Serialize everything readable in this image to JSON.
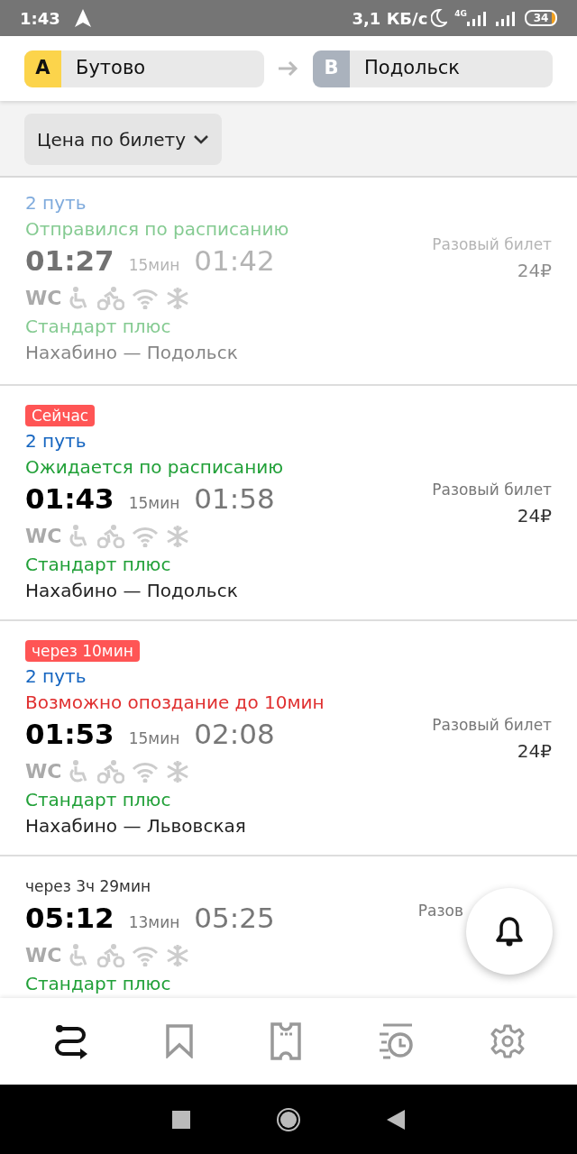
{
  "status_bar": {
    "time": "1:43",
    "speed": "3,1 КБ/с",
    "network": "4G",
    "battery": "34"
  },
  "route": {
    "from": {
      "letter": "A",
      "name": "Бутово"
    },
    "to": {
      "letter": "B",
      "name": "Подольск"
    }
  },
  "filter": {
    "label": "Цена по билету"
  },
  "trains": [
    {
      "departed": true,
      "platform": "2 путь",
      "status": {
        "kind": "departed",
        "text": "Отправился по расписанию"
      },
      "depart": "01:27",
      "duration": "15мин",
      "arrive": "01:42",
      "toilet": "WC",
      "train_class": "Стандарт плюс",
      "route": "Нахабино — Подольск",
      "ticket": "Разовый билет",
      "price": "24₽"
    },
    {
      "departed": false,
      "badge": {
        "kind": "label",
        "text": "Сейчас"
      },
      "platform": "2 путь",
      "status": {
        "kind": "ontime",
        "text": "Ожидается по расписанию"
      },
      "depart": "01:43",
      "duration": "15мин",
      "arrive": "01:58",
      "toilet": "WC",
      "train_class": "Стандарт плюс",
      "route": "Нахабино — Подольск",
      "ticket": "Разовый билет",
      "price": "24₽"
    },
    {
      "departed": false,
      "badge": {
        "kind": "label",
        "text": "через 10мин"
      },
      "platform": "2 путь",
      "status": {
        "kind": "delay",
        "text": "Возможно опоздание до 10мин"
      },
      "depart": "01:53",
      "duration": "15мин",
      "arrive": "02:08",
      "toilet": "WC",
      "train_class": "Стандарт плюс",
      "route": "Нахабино — Львовская",
      "ticket": "Разовый билет",
      "price": "24₽"
    },
    {
      "departed": false,
      "badge": {
        "kind": "plain",
        "text": "через 3ч 29мин"
      },
      "depart": "05:12",
      "duration": "13мин",
      "arrive": "05:25",
      "toilet": "WC",
      "train_class": "Стандарт плюс",
      "ticket": "Разов"
    }
  ],
  "tabs": [
    {
      "selected": true
    },
    {
      "selected": false
    },
    {
      "selected": false
    },
    {
      "selected": false
    },
    {
      "selected": false
    }
  ]
}
